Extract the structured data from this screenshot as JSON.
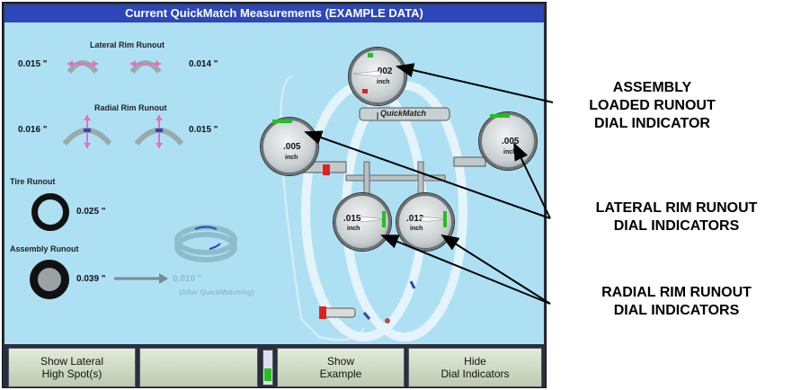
{
  "title": "Current QuickMatch Measurements (EXAMPLE DATA)",
  "lateral": {
    "label": "Lateral Rim Runout",
    "left": "0.015 \"",
    "right": "0.014 \""
  },
  "radial": {
    "label": "Radial Rim Runout",
    "left": "0.016 \"",
    "right": "0.015 \""
  },
  "tire": {
    "label": "Tire Runout",
    "value": "0.025 \""
  },
  "assembly": {
    "label": "Assembly Runout",
    "value": "0.039 \"",
    "after_value": "0.010 \"",
    "after_note": "(After QuickMatching)"
  },
  "dials": {
    "top": {
      "reading": ".002",
      "unit": "inch"
    },
    "left": {
      "reading": ".005",
      "unit": "inch"
    },
    "right": {
      "reading": ".005",
      "unit": "inch"
    },
    "bottom_left": {
      "reading": ".015",
      "unit": "inch"
    },
    "bottom_right": {
      "reading": ".013",
      "unit": "inch"
    }
  },
  "machine_label": "QuickMatch",
  "buttons": [
    {
      "label": "Show Lateral\nHigh Spot(s)"
    },
    {
      "label": ""
    },
    {
      "label": "Show\nExample"
    },
    {
      "label": "Hide\nDial Indicators"
    }
  ],
  "callouts": {
    "assembly": "ASSEMBLY\nLOADED RUNOUT\nDIAL INDICATOR",
    "lateral": "LATERAL RIM RUNOUT\nDIAL INDICATORS",
    "radial": "RADIAL RIM RUNOUT\nDIAL INDICATORS"
  },
  "colors": {
    "title_bg": "#2b47b8",
    "panel_bg": "#aee0f4",
    "needle": "#ffffff",
    "indicator_green": "#22c022",
    "indicator_red": "#e02020",
    "arrow_pink": "#e76fc1"
  }
}
